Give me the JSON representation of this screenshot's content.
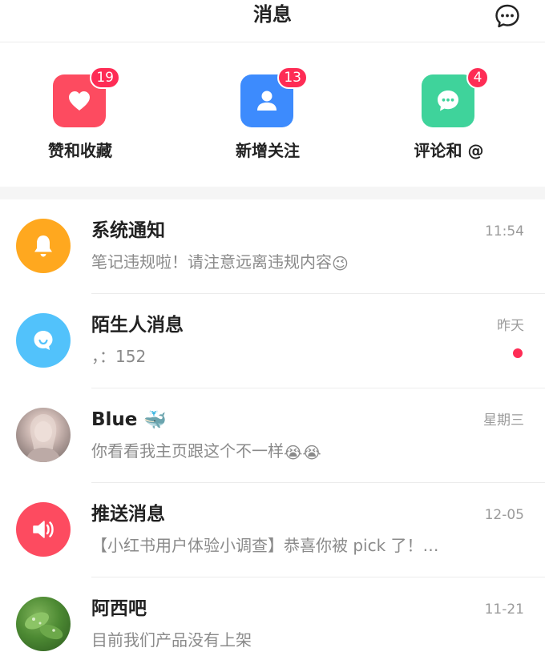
{
  "header": {
    "title": "消息",
    "chat_icon": "chat-bubble-icon"
  },
  "shortcuts": [
    {
      "label": "赞和收藏",
      "badge": "19",
      "color": "#fd4b60",
      "icon": "heart-icon"
    },
    {
      "label": "新增关注",
      "badge": "13",
      "color": "#3d8bfd",
      "icon": "person-icon"
    },
    {
      "label": "评论和 @",
      "badge": "4",
      "color": "#3fd39b",
      "icon": "comment-icon"
    }
  ],
  "messages": [
    {
      "name": "系统通知",
      "preview": "笔记违规啦！请注意远离违规内容",
      "preview_emoji": "😉",
      "time": "11:54",
      "avatar_color": "#ffa81f",
      "avatar_icon": "bell-icon"
    },
    {
      "name": "陌生人消息",
      "preview": "，：152",
      "time": "昨天",
      "avatar_color": "#52c2fb",
      "avatar_icon": "smile-bubble-icon",
      "unread": true
    },
    {
      "name": "Blue",
      "name_emoji": "🐳",
      "preview": "你看看我主页跟这个不一样",
      "preview_emoji": "😭😭",
      "time": "星期三",
      "avatar_icon": "user-avatar-photo"
    },
    {
      "name": "推送消息",
      "preview": "【小红书用户体验小调查】恭喜你被 pick 了！…",
      "time": "12-05",
      "avatar_color": "#fd4b60",
      "avatar_icon": "speaker-icon"
    },
    {
      "name": "阿西吧",
      "preview": "目前我们产品没有上架",
      "time": "11-21",
      "avatar_icon": "leaf-photo"
    }
  ]
}
